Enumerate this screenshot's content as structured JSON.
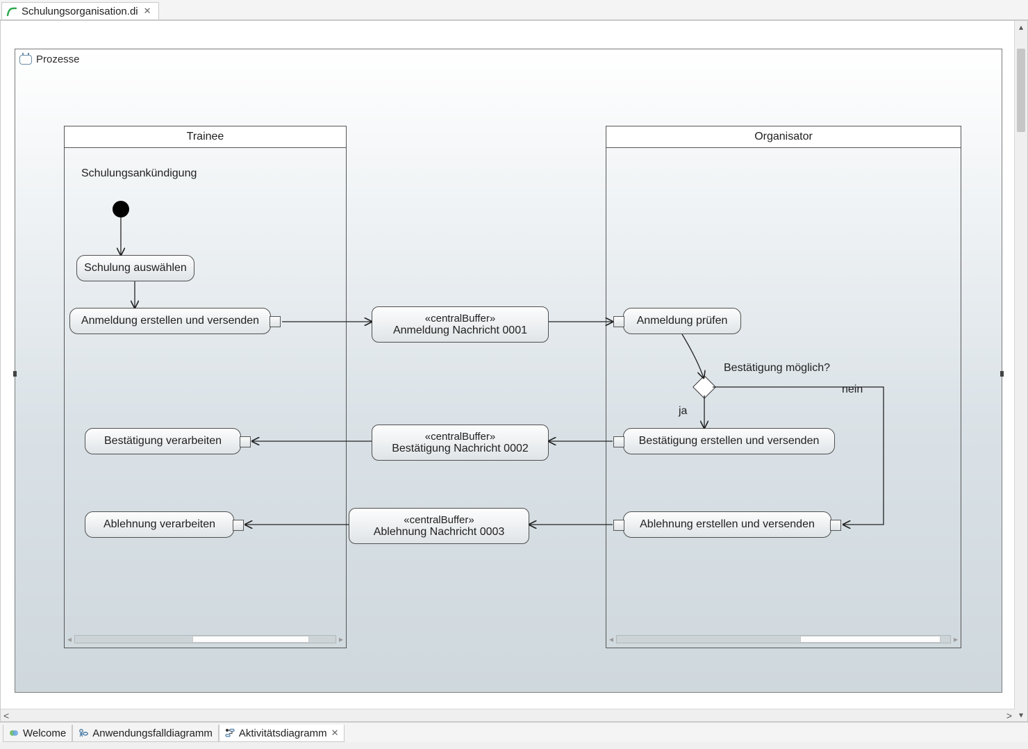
{
  "top_tab": {
    "title": "Schulungsorganisation.di"
  },
  "frame": {
    "title": "Prozesse"
  },
  "lanes": {
    "trainee": "Trainee",
    "organisator": "Organisator"
  },
  "labels": {
    "announcement": "Schulungsankündigung",
    "decision_question": "Bestätigung möglich?",
    "guard_yes": "ja",
    "guard_no": "nein"
  },
  "actions": {
    "select_training": "Schulung auswählen",
    "create_registration": "Anmeldung erstellen und versenden",
    "check_registration": "Anmeldung prüfen",
    "create_confirmation": "Bestätigung erstellen und versenden",
    "process_confirmation": "Bestätigung verarbeiten",
    "create_rejection": "Ablehnung erstellen und versenden",
    "process_rejection": "Ablehnung verarbeiten"
  },
  "buffers": {
    "stereotype": "«centralBuffer»",
    "msg1": "Anmeldung Nachricht 0001",
    "msg2": "Bestätigung Nachricht 0002",
    "msg3": "Ablehnung Nachricht 0003"
  },
  "bottom_tabs": {
    "welcome": "Welcome",
    "usecase": "Anwendungsfalldiagramm",
    "activity": "Aktivitätsdiagramm"
  }
}
